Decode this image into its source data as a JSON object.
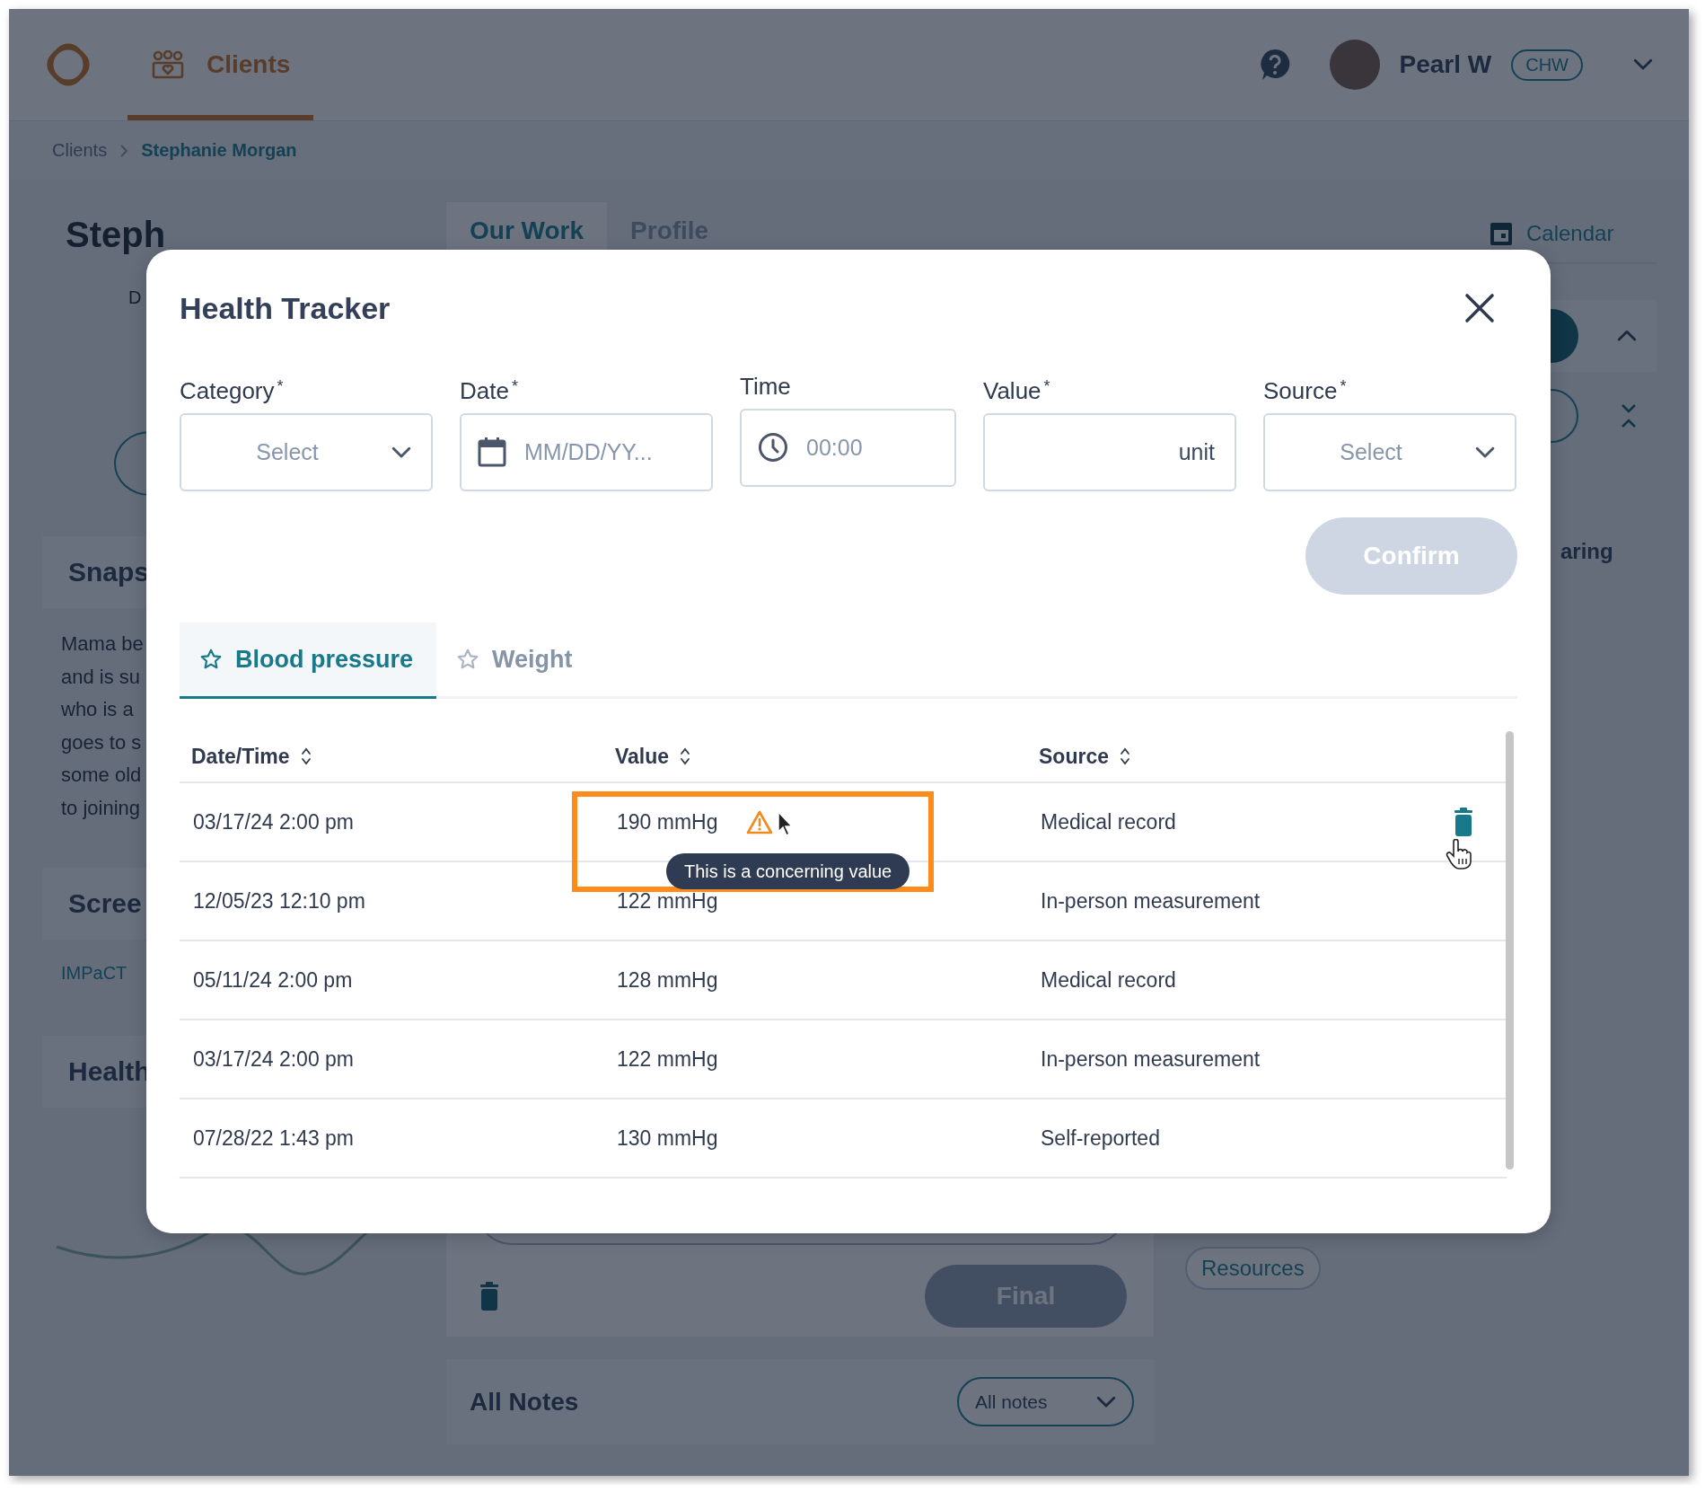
{
  "header": {
    "nav": [
      {
        "label": "Clients",
        "selected": true
      }
    ],
    "user": {
      "name": "Pearl W",
      "role": "CHW"
    }
  },
  "breadcrumb": [
    {
      "label": "Clients",
      "current": false
    },
    {
      "label": "Stephanie Morgan",
      "current": true
    }
  ],
  "client": {
    "name": "Steph",
    "subtitle": "D",
    "sections": [
      {
        "title": "Snaps",
        "lines": [
          "Mama be",
          "and is su",
          "who is a",
          "goes to s",
          "some old",
          "to joining"
        ]
      },
      {
        "title": "Scree",
        "links": [
          "IMPaCT"
        ]
      },
      {
        "title": "Health"
      }
    ]
  },
  "page_tabs": [
    {
      "label": "Our Work",
      "selected": true
    },
    {
      "label": "Profile",
      "selected": false
    }
  ],
  "calendar": {
    "label": "Calendar"
  },
  "side_text": "aring",
  "resources_tag": "Resources",
  "final_button": {
    "label": "Final",
    "disabled": true
  },
  "all_notes": {
    "title": "All Notes",
    "filter": "All notes"
  },
  "modal": {
    "title": "Health Tracker",
    "fields": [
      {
        "kind": "select",
        "label": "Category",
        "required_mark": "*",
        "placeholder": "Select"
      },
      {
        "kind": "date",
        "label": "Date",
        "required_mark": "*",
        "placeholder": "MM/DD/YY..."
      },
      {
        "kind": "time",
        "label": "Time",
        "placeholder": "00:00"
      },
      {
        "kind": "value",
        "label": "Value",
        "required_mark": "*",
        "unit": "unit"
      },
      {
        "kind": "select",
        "label": "Source",
        "required_mark": "*",
        "placeholder": "Select"
      }
    ],
    "confirm": {
      "label": "Confirm",
      "disabled": true
    },
    "tabs": [
      {
        "label": "Blood pressure",
        "selected": true
      },
      {
        "label": "Weight",
        "selected": false
      }
    ],
    "table": {
      "columns": [
        "Date/Time",
        "Value",
        "Source"
      ],
      "rows": [
        {
          "datetime": "03/17/24 2:00 pm",
          "value": "190 mmHg",
          "source": "Medical record",
          "concerning": true,
          "hovered": true
        },
        {
          "datetime": "12/05/23 12:10 pm",
          "value": "122 mmHg",
          "source": "In-person measurement",
          "concerning": false,
          "hovered": false
        },
        {
          "datetime": "05/11/24 2:00 pm",
          "value": "128 mmHg",
          "source": "Medical record",
          "concerning": false,
          "hovered": false
        },
        {
          "datetime": "03/17/24 2:00 pm",
          "value": "122 mmHg",
          "source": "In-person measurement",
          "concerning": false,
          "hovered": false
        },
        {
          "datetime": "07/28/22 1:43 pm",
          "value": "130 mmHg",
          "source": "Self-reported",
          "concerning": false,
          "hovered": false
        }
      ]
    },
    "tooltip": "This is a concerning value"
  }
}
